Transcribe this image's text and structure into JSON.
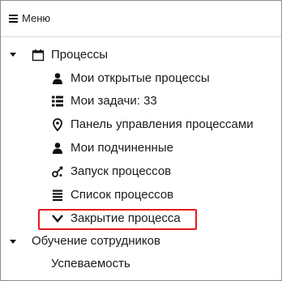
{
  "header": {
    "title": "Меню"
  },
  "tree": {
    "processes": {
      "label": "Процессы",
      "children": [
        {
          "label": "Мои открытые процессы",
          "icon": "user-icon"
        },
        {
          "label": "Мои задачи: 33",
          "icon": "task-list-icon"
        },
        {
          "label": "Панель управления процессами",
          "icon": "map-pin-icon"
        },
        {
          "label": "Мои подчиненные",
          "icon": "user-icon"
        },
        {
          "label": "Запуск процессов",
          "icon": "process-launch-icon"
        },
        {
          "label": "Список процессов",
          "icon": "list-icon"
        },
        {
          "label": "Закрытие процесса",
          "icon": "chevron-down-icon"
        }
      ]
    },
    "training": {
      "label": "Обучение сотрудников",
      "children": [
        {
          "label": "Успеваемость"
        }
      ]
    }
  },
  "colors": {
    "highlight_border": "#e31b1b",
    "text": "#1a1a1a",
    "frame_border": "#8d8d8d"
  }
}
